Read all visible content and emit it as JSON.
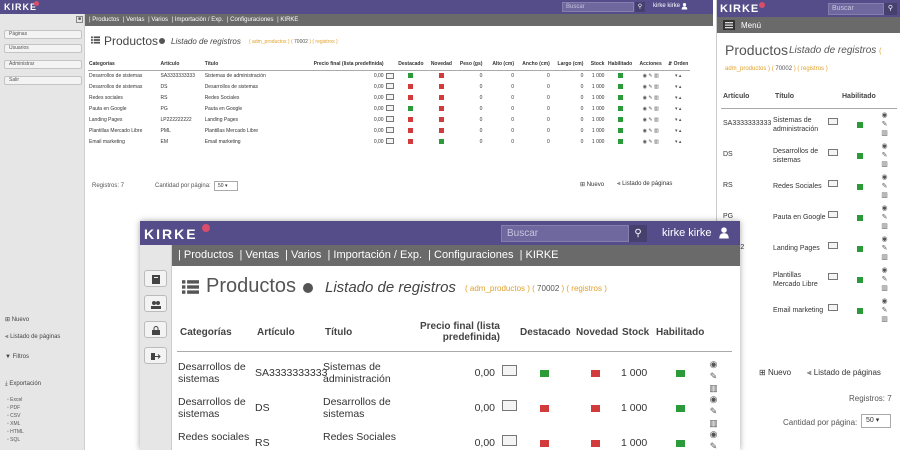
{
  "brand": {
    "name": "KIRKE",
    "accent": "#554d8a",
    "dot": "#d94c6b"
  },
  "search": {
    "placeholder": "Buscar"
  },
  "user": {
    "name": "kirke kirke"
  },
  "nav": [
    "| Productos",
    "| Ventas",
    "| Varios",
    "| Importación / Exp.",
    "| Configuraciones",
    "| KIRKE"
  ],
  "sidebar": {
    "buttons": [
      "Páginas",
      "Usuarios",
      "Administrar",
      "Salir"
    ],
    "links": {
      "nuevo": "Nuevo",
      "listado": "Listado de páginas",
      "filtros": "Filtros",
      "exportacion": "Exportación"
    },
    "export_items": [
      "Excel",
      "PDF",
      "CSV",
      "XML",
      "HTML",
      "SQL"
    ]
  },
  "page": {
    "title": "Productos",
    "subtitle": "Listado de registros",
    "meta_open": "( adm_productos ) (",
    "meta_num": "70002",
    "meta_close": ") ( registros )"
  },
  "table": {
    "columns": [
      "Categorías",
      "Artículo",
      "Título",
      "Precio final (lista predefinida)",
      "Destacado",
      "Novedad",
      "Peso (gs)",
      "Alto (cm)",
      "Ancho (cm)",
      "Largo (cm)",
      "Stock",
      "Habilitado",
      "Acciones",
      "Orden"
    ],
    "rows": [
      {
        "cat": "Desarrollos de sistemas",
        "art": "SA3333333333",
        "tit": "Sistemas de administración",
        "precio": "0,00",
        "dest": "green",
        "nov": "red",
        "peso": "0",
        "alto": "0",
        "ancho": "0",
        "largo": "0",
        "stock": "1 000",
        "hab": "green"
      },
      {
        "cat": "Desarrollos de sistemas",
        "art": "DS",
        "tit": "Desarrollos de sistemas",
        "precio": "0,00",
        "dest": "red",
        "nov": "red",
        "peso": "0",
        "alto": "0",
        "ancho": "0",
        "largo": "0",
        "stock": "1 000",
        "hab": "green"
      },
      {
        "cat": "Redes sociales",
        "art": "RS",
        "tit": "Redes Sociales",
        "precio": "0,00",
        "dest": "red",
        "nov": "red",
        "peso": "0",
        "alto": "0",
        "ancho": "0",
        "largo": "0",
        "stock": "1 000",
        "hab": "green"
      },
      {
        "cat": "Pauta en Google",
        "art": "PG",
        "tit": "Pauta en Google",
        "precio": "0,00",
        "dest": "green",
        "nov": "red",
        "peso": "0",
        "alto": "0",
        "ancho": "0",
        "largo": "0",
        "stock": "1 000",
        "hab": "green"
      },
      {
        "cat": "Landing Pages",
        "art": "LP222222222",
        "tit": "Landing Pages",
        "precio": "0,00",
        "dest": "red",
        "nov": "red",
        "peso": "0",
        "alto": "0",
        "ancho": "0",
        "largo": "0",
        "stock": "1 000",
        "hab": "green"
      },
      {
        "cat": "Plantillas Mercado Libre",
        "art": "PML",
        "tit": "Plantillas Mercado Libre",
        "precio": "0,00",
        "dest": "red",
        "nov": "red",
        "peso": "0",
        "alto": "0",
        "ancho": "0",
        "largo": "0",
        "stock": "1 000",
        "hab": "green"
      },
      {
        "cat": "Email marketing",
        "art": "EM",
        "tit": "Email marketing",
        "precio": "0,00",
        "dest": "red",
        "nov": "green",
        "peso": "0",
        "alto": "0",
        "ancho": "0",
        "largo": "0",
        "stock": "1 000",
        "hab": "green"
      }
    ]
  },
  "footer": {
    "registros": "Registros: 7",
    "cantidad": "Cantidad por página:",
    "per_page": "50",
    "nuevo": "Nuevo",
    "listado": "Listado de páginas"
  },
  "mobile": {
    "menu": "Menú",
    "columns": [
      "Artículo",
      "Título",
      "Habilitado"
    ],
    "partial_art": "PG",
    "partial_lp": "2222222"
  }
}
